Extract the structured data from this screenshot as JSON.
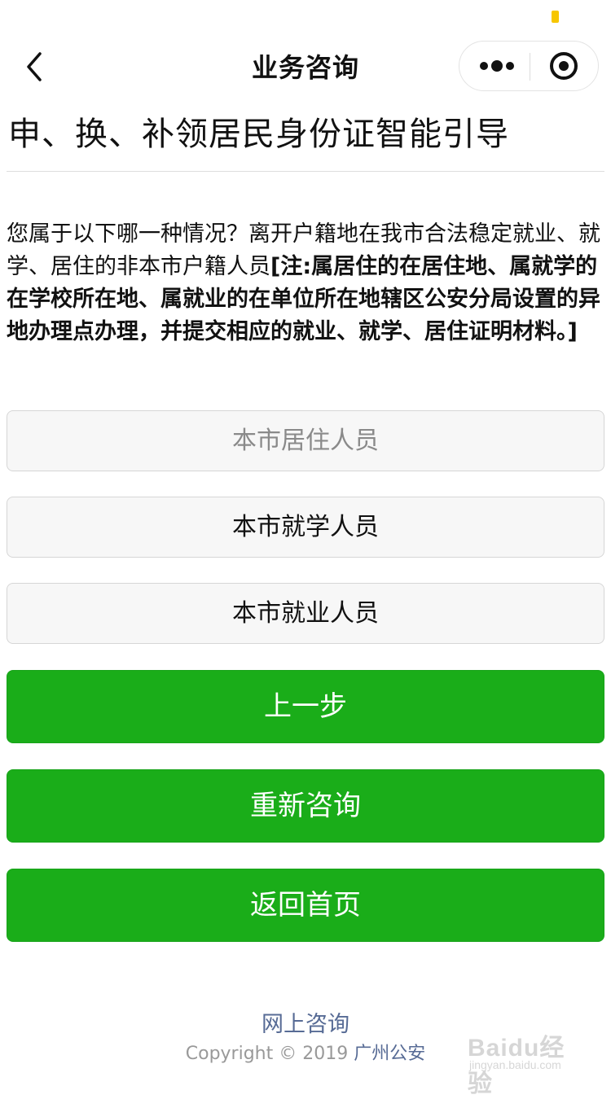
{
  "nav": {
    "title": "业务咨询"
  },
  "page": {
    "title": "申、换、补领居民身份证智能引导",
    "question_plain": "您属于以下哪一种情况？离开户籍地在我市合法稳定就业、就学、居住的非本市户籍人员",
    "question_note": "[注:属居住的在居住地、属就学的在学校所在地、属就业的在单位所在地辖区公安分局设置的异地办理点办理，并提交相应的就业、就学、居住证明材料。]"
  },
  "options": [
    {
      "label": "本市居住人员",
      "state": "disabled"
    },
    {
      "label": "本市就学人员",
      "state": "normal"
    },
    {
      "label": "本市就业人员",
      "state": "normal"
    }
  ],
  "actions": {
    "prev_label": "上一步",
    "restart_label": "重新咨询",
    "home_label": "返回首页"
  },
  "footer": {
    "link_label": "网上咨询",
    "copyright_prefix": "Copyright © 2019",
    "copyright_org": "广州公安"
  },
  "watermark": {
    "main": "Baidu经验",
    "sub": "jingyan.baidu.com"
  },
  "colors": {
    "primary_green": "#1aad19",
    "link_blue": "#576b95",
    "status_indicator": "#f7c600"
  },
  "icons": {
    "back": "chevron-left-icon",
    "more": "more-dots-icon",
    "close": "target-close-icon"
  }
}
